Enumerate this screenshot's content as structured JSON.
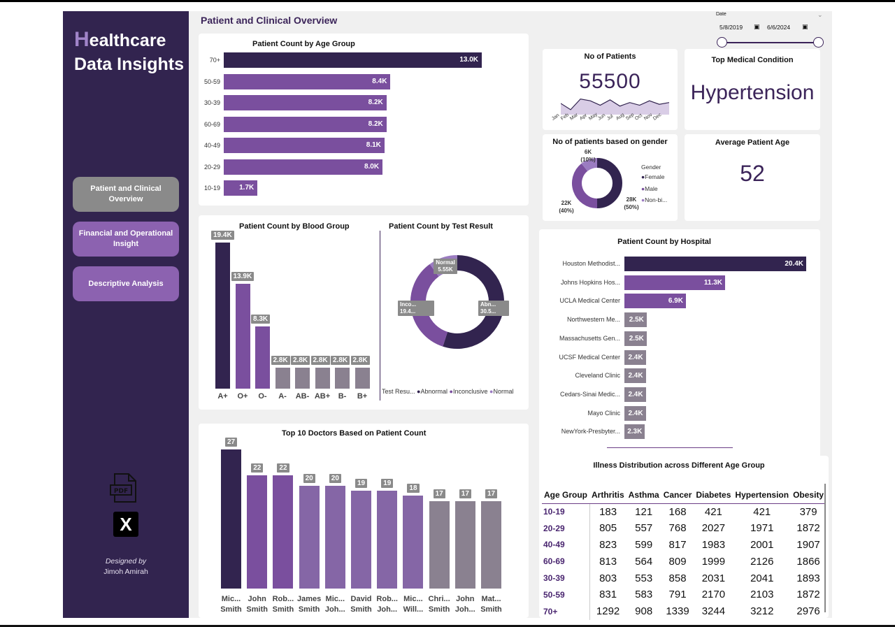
{
  "sidebar": {
    "logo_first": "H",
    "logo_rest": "ealthcare",
    "logo_line2": "Data Insights",
    "nav": [
      {
        "label": "Patient and Clinical Overview",
        "active": true
      },
      {
        "label": "Financial and Operational Insight",
        "active": false
      },
      {
        "label": "Descriptive Analysis",
        "active": false
      }
    ],
    "pdf_icon": "pdf-icon",
    "pdf_text": "PDF",
    "x_icon": "x-logo-icon",
    "x_text": "X",
    "designed_by": "Designed by",
    "designer": "Jimoh Amirah"
  },
  "page": {
    "title": "Patient and Clinical Overview"
  },
  "date_slicer": {
    "label": "Date",
    "start": "5/8/2019",
    "end": "6/6/2024",
    "calendar_icon": "calendar-icon"
  },
  "kpis": {
    "patients_title": "No of Patients",
    "patients_value": "55500",
    "months": [
      "Jan",
      "Feb",
      "Mar",
      "Apr",
      "May",
      "Jun",
      "Jul",
      "Aug",
      "Sep",
      "Oct",
      "Nov",
      "Dec"
    ],
    "sparkline": [
      0.55,
      0.2,
      0.8,
      0.7,
      0.45,
      0.75,
      0.4,
      0.6,
      0.45,
      0.7,
      0.5,
      0.6
    ],
    "condition_title": "Top Medical Condition",
    "condition_value": "Hypertension",
    "age_title": "Average Patient Age",
    "age_value": "52"
  },
  "colors": {
    "dark": "#32244f",
    "mid": "#7a4f9e",
    "light": "#9b7cc1",
    "grey": "#8a8190",
    "accent": "#3b2459"
  },
  "chart_data": [
    {
      "type": "bar",
      "orientation": "horizontal",
      "title": "Patient Count by Age Group",
      "categories": [
        "70+",
        "50-59",
        "30-39",
        "60-69",
        "40-49",
        "20-29",
        "10-19"
      ],
      "values": [
        13000,
        8400,
        8200,
        8200,
        8100,
        8000,
        1700
      ],
      "labels": [
        "13.0K",
        "8.4K",
        "8.2K",
        "8.2K",
        "8.1K",
        "8.0K",
        "1.7K"
      ]
    },
    {
      "type": "bar",
      "title": "Patient Count by Blood Group",
      "categories": [
        "A+",
        "O+",
        "O-",
        "A-",
        "AB-",
        "AB+",
        "B-",
        "B+"
      ],
      "values": [
        19400,
        13900,
        8300,
        2800,
        2800,
        2800,
        2800,
        2800
      ],
      "labels": [
        "19.4K",
        "13.9K",
        "8.3K",
        "2.8K",
        "2.8K",
        "2.8K",
        "2.8K",
        "2.8K"
      ]
    },
    {
      "type": "pie",
      "title": "Patient Count by Test Result",
      "legend_title": "Test Resu...",
      "categories": [
        "Abnormal",
        "Inconclusive",
        "Normal"
      ],
      "values": [
        30500,
        19400,
        5550
      ],
      "labels": [
        "Abn... 30.5...",
        "Inco... 19.4...",
        "Normal 5.55K"
      ]
    },
    {
      "type": "pie",
      "title": "No of patients based on gender",
      "legend_title": "Gender",
      "categories": [
        "Female",
        "Male",
        "Non-bi..."
      ],
      "values": [
        28000,
        22000,
        6000
      ],
      "labels": [
        "28K (50%)",
        "22K (40%)",
        "6K (10%)"
      ]
    },
    {
      "type": "bar",
      "orientation": "horizontal",
      "title": "Patient Count by Hospital",
      "categories": [
        "Houston Methodist...",
        "Johns Hopkins Hos...",
        "UCLA Medical Center",
        "Northwestern Me...",
        "Massachusetts Gen...",
        "UCSF Medical Center",
        "Cleveland Clinic",
        "Cedars-Sinai Medic...",
        "Mayo Clinic",
        "NewYork-Presbyter..."
      ],
      "values": [
        20400,
        11300,
        6900,
        2500,
        2500,
        2400,
        2400,
        2400,
        2400,
        2300
      ],
      "labels": [
        "20.4K",
        "11.3K",
        "6.9K",
        "2.5K",
        "2.5K",
        "2.4K",
        "2.4K",
        "2.4K",
        "2.4K",
        "2.3K"
      ]
    },
    {
      "type": "bar",
      "title": "Top 10 Doctors Based on Patient Count",
      "categories": [
        [
          "Mic...",
          "Smith"
        ],
        [
          "John",
          "Smith"
        ],
        [
          "Rob...",
          "Smith"
        ],
        [
          "James",
          "Smith"
        ],
        [
          "Mic...",
          "Joh..."
        ],
        [
          "David",
          "Smith"
        ],
        [
          "Rob...",
          "Joh..."
        ],
        [
          "Mic...",
          "Will..."
        ],
        [
          "Chri...",
          "Smith"
        ],
        [
          "John",
          "Joh..."
        ],
        [
          "Mat...",
          "Smith"
        ]
      ],
      "values": [
        27,
        22,
        22,
        20,
        20,
        19,
        19,
        18,
        17,
        17,
        17
      ]
    },
    {
      "type": "table",
      "title": "Illness Distribution across Different Age Group",
      "columns": [
        "Age Group",
        "Arthritis",
        "Asthma",
        "Cancer",
        "Diabetes",
        "Hypertension",
        "Obesity"
      ],
      "rows": [
        [
          "10-19",
          "183",
          "121",
          "168",
          "421",
          "421",
          "379"
        ],
        [
          "20-29",
          "805",
          "557",
          "768",
          "2027",
          "1971",
          "1872"
        ],
        [
          "40-49",
          "823",
          "599",
          "817",
          "1983",
          "2001",
          "1907"
        ],
        [
          "60-69",
          "813",
          "564",
          "809",
          "1999",
          "2126",
          "1866"
        ],
        [
          "30-39",
          "803",
          "553",
          "858",
          "2031",
          "2041",
          "1893"
        ],
        [
          "50-59",
          "831",
          "583",
          "791",
          "2170",
          "2103",
          "1872"
        ],
        [
          "70+",
          "1292",
          "908",
          "1339",
          "3244",
          "3212",
          "2976"
        ]
      ]
    }
  ]
}
